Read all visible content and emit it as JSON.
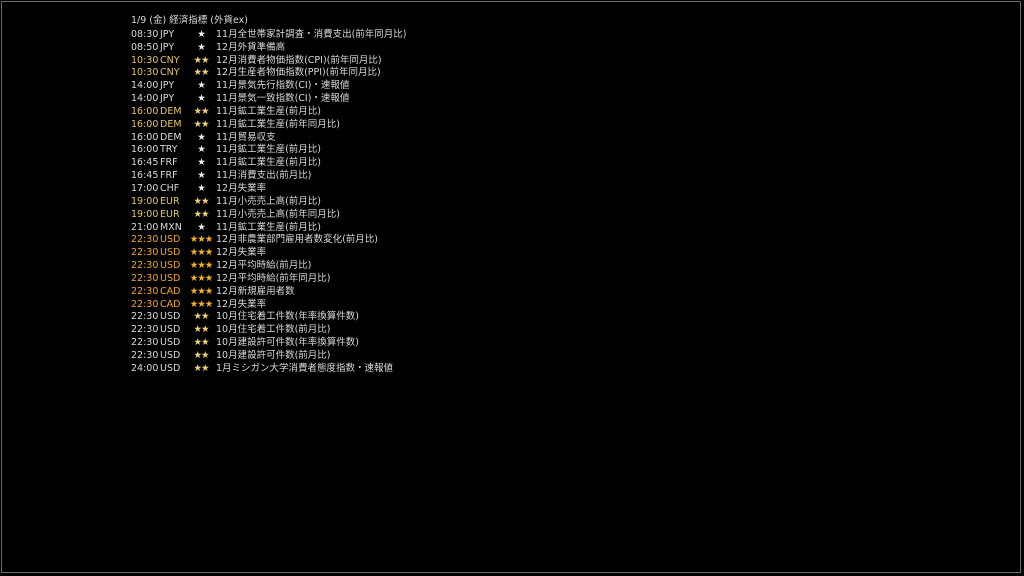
{
  "header": {
    "title": "1/9 (金) 経済指標 (外貨ex)"
  },
  "colors": {
    "background": "#000000",
    "text": "#d9d9d9",
    "gold": "#e3c56f",
    "orange": "#f0a530"
  },
  "events": [
    {
      "time": "08:30",
      "currency": "JPY",
      "stars": "★",
      "name": "11月全世帯家計調査・消費支出(前年同月比)"
    },
    {
      "time": "08:50",
      "currency": "JPY",
      "stars": "★",
      "name": "12月外貨準備高"
    },
    {
      "time": "10:30",
      "currency": "CNY",
      "stars": "★★",
      "name": "12月消費者物価指数(CPI)(前年同月比)"
    },
    {
      "time": "10:30",
      "currency": "CNY",
      "stars": "★★",
      "name": "12月生産者物価指数(PPI)(前年同月比)"
    },
    {
      "time": "14:00",
      "currency": "JPY",
      "stars": "★",
      "name": "11月景気先行指数(CI)・速報値"
    },
    {
      "time": "14:00",
      "currency": "JPY",
      "stars": "★",
      "name": "11月景気一致指数(CI)・速報値"
    },
    {
      "time": "16:00",
      "currency": "DEM",
      "stars": "★★",
      "name": "11月鉱工業生産(前月比)"
    },
    {
      "time": "16:00",
      "currency": "DEM",
      "stars": "★★",
      "name": "11月鉱工業生産(前年同月比)"
    },
    {
      "time": "16:00",
      "currency": "DEM",
      "stars": "★",
      "name": "11月貿易収支"
    },
    {
      "time": "16:00",
      "currency": "TRY",
      "stars": "★",
      "name": "11月鉱工業生産(前月比)"
    },
    {
      "time": "16:45",
      "currency": "FRF",
      "stars": "★",
      "name": "11月鉱工業生産(前月比)"
    },
    {
      "time": "16:45",
      "currency": "FRF",
      "stars": "★",
      "name": "11月消費支出(前月比)"
    },
    {
      "time": "17:00",
      "currency": "CHF",
      "stars": "★",
      "name": "12月失業率"
    },
    {
      "time": "19:00",
      "currency": "EUR",
      "stars": "★★",
      "name": "11月小売売上高(前月比)"
    },
    {
      "time": "19:00",
      "currency": "EUR",
      "stars": "★★",
      "name": "11月小売売上高(前年同月比)"
    },
    {
      "time": "21:00",
      "currency": "MXN",
      "stars": "★",
      "name": "11月鉱工業生産(前月比)"
    },
    {
      "time": "22:30",
      "currency": "USD",
      "stars": "★★★",
      "name": "12月非農業部門雇用者数変化(前月比)"
    },
    {
      "time": "22:30",
      "currency": "USD",
      "stars": "★★★",
      "name": "12月失業率"
    },
    {
      "time": "22:30",
      "currency": "USD",
      "stars": "★★★",
      "name": "12月平均時給(前月比)"
    },
    {
      "time": "22:30",
      "currency": "USD",
      "stars": "★★★",
      "name": "12月平均時給(前年同月比)"
    },
    {
      "time": "22:30",
      "currency": "CAD",
      "stars": "★★★",
      "name": "12月新規雇用者数"
    },
    {
      "time": "22:30",
      "currency": "CAD",
      "stars": "★★★",
      "name": "12月失業率"
    },
    {
      "time": "22:30",
      "currency": "USD",
      "stars": "★★",
      "name": "10月住宅着工件数(年率換算件数)"
    },
    {
      "time": "22:30",
      "currency": "USD",
      "stars": "★★",
      "name": "10月住宅着工件数(前月比)"
    },
    {
      "time": "22:30",
      "currency": "USD",
      "stars": "★★",
      "name": "10月建設許可件数(年率換算件数)"
    },
    {
      "time": "22:30",
      "currency": "USD",
      "stars": "★★",
      "name": "10月建設許可件数(前月比)"
    },
    {
      "time": "24:00",
      "currency": "USD",
      "stars": "★★",
      "name": "1月ミシガン大学消費者態度指数・速報値"
    }
  ]
}
